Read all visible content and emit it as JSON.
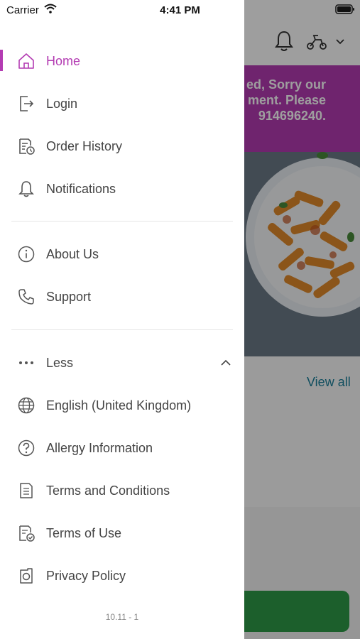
{
  "status_bar": {
    "carrier": "Carrier",
    "time": "4:41 PM"
  },
  "background": {
    "banner_text": "ed, Sorry our\nment. Please\n914696240.",
    "view_all": "View all",
    "colors": {
      "banner": "#b33bb2",
      "link": "#1a7f99",
      "button": "#2e9a48"
    }
  },
  "drawer": {
    "accent": "#b33bb2",
    "primary": [
      {
        "label": "Home",
        "icon": "home-icon",
        "active": true
      },
      {
        "label": "Login",
        "icon": "login-icon"
      },
      {
        "label": "Order History",
        "icon": "order-history-icon"
      },
      {
        "label": "Notifications",
        "icon": "bell-icon"
      }
    ],
    "secondary": [
      {
        "label": "About Us",
        "icon": "info-icon"
      },
      {
        "label": "Support",
        "icon": "phone-icon"
      }
    ],
    "more_toggle": {
      "label": "Less",
      "icon": "more-dots-icon"
    },
    "extra": [
      {
        "label": "English (United Kingdom)",
        "icon": "globe-icon"
      },
      {
        "label": "Allergy Information",
        "icon": "question-icon"
      },
      {
        "label": "Terms and Conditions",
        "icon": "document-icon"
      },
      {
        "label": "Terms of Use",
        "icon": "document-check-icon"
      },
      {
        "label": "Privacy Policy",
        "icon": "privacy-icon"
      }
    ],
    "version": "10.11 - 1"
  }
}
